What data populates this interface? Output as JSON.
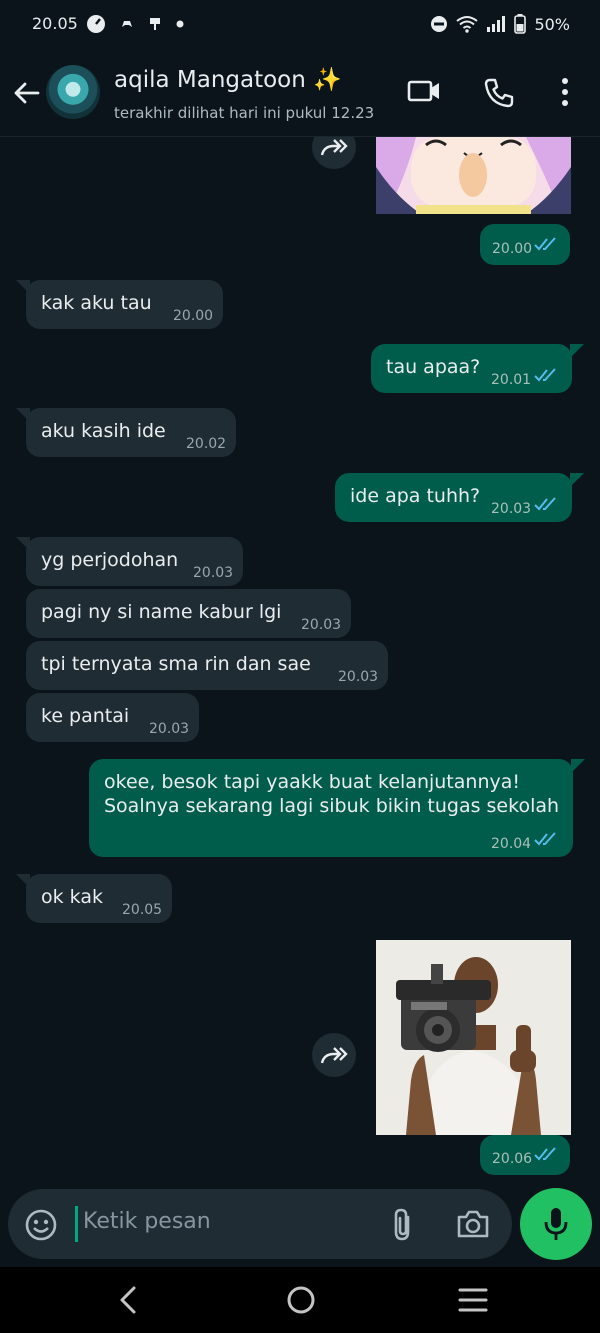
{
  "status_bar": {
    "time": "20.05",
    "battery": "50%"
  },
  "header": {
    "contact_name": "aqila Mangatoon ✨",
    "last_seen": "terakhir dilihat hari ini pukul 12.23"
  },
  "messages": [
    {
      "dir": "out",
      "type": "image",
      "time": "20.00",
      "read": true
    },
    {
      "dir": "in",
      "text": "kak aku tau",
      "time": "20.00"
    },
    {
      "dir": "out",
      "text": "tau apaa?",
      "time": "20.01",
      "read": true
    },
    {
      "dir": "in",
      "text": "aku kasih ide",
      "time": "20.02"
    },
    {
      "dir": "out",
      "text": "ide apa tuhh?",
      "time": "20.03",
      "read": true
    },
    {
      "dir": "in",
      "text": "yg perjodohan",
      "time": "20.03"
    },
    {
      "dir": "in",
      "text": "pagi ny si name kabur lgi",
      "time": "20.03"
    },
    {
      "dir": "in",
      "text": "tpi ternyata sma rin dan sae",
      "time": "20.03"
    },
    {
      "dir": "in",
      "text": "ke pantai",
      "time": "20.03"
    },
    {
      "dir": "out",
      "text_lines": [
        "okee, besok tapi yaakk buat kelanjutannya!",
        "Soalnya sekarang lagi sibuk bikin tugas sekolah"
      ],
      "time": "20.04",
      "read": true
    },
    {
      "dir": "in",
      "text": "ok kak",
      "time": "20.05"
    },
    {
      "dir": "out",
      "type": "image",
      "time": "20.06",
      "read": true
    }
  ],
  "input": {
    "placeholder": "Ketik pesan"
  },
  "colors": {
    "background": "#0b141a",
    "incoming": "#1f2c33",
    "outgoing": "#005c4b",
    "accent": "#21c063",
    "read_ticks": "#53bdeb"
  },
  "icons": [
    "back-arrow-icon",
    "video-call-icon",
    "voice-call-icon",
    "more-options-icon",
    "forward-icon",
    "read-ticks-icon",
    "emoji-icon",
    "attach-icon",
    "camera-icon",
    "mic-icon",
    "nav-back-icon",
    "nav-home-icon",
    "nav-recents-icon"
  ]
}
